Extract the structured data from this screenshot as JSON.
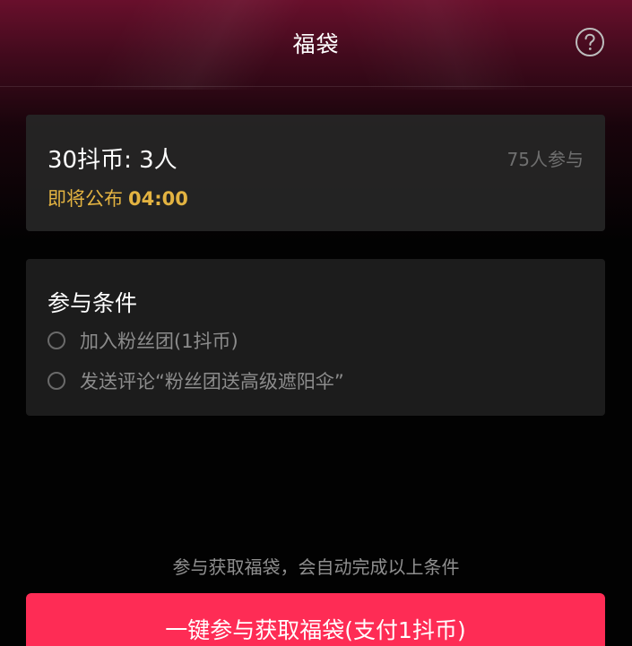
{
  "header": {
    "title": "福袋",
    "help_icon": "help-circle-icon"
  },
  "prize": {
    "reward": "30抖币: 3人",
    "participants": "75人参与",
    "publish_label": "即将公布",
    "publish_time": "04:00"
  },
  "conditions": {
    "title": "参与条件",
    "items": [
      {
        "label": "加入粉丝团(1抖币)",
        "checked": false
      },
      {
        "label": "发送评论“粉丝团送高级遮阳伞”",
        "checked": false
      }
    ]
  },
  "footer": {
    "hint": "参与获取福袋，会自动完成以上条件",
    "cta_label": "一键参与获取福袋(支付1抖币)"
  },
  "colors": {
    "accent": "#fe2c55",
    "gold": "#e3b341",
    "header": "#6e102e"
  }
}
